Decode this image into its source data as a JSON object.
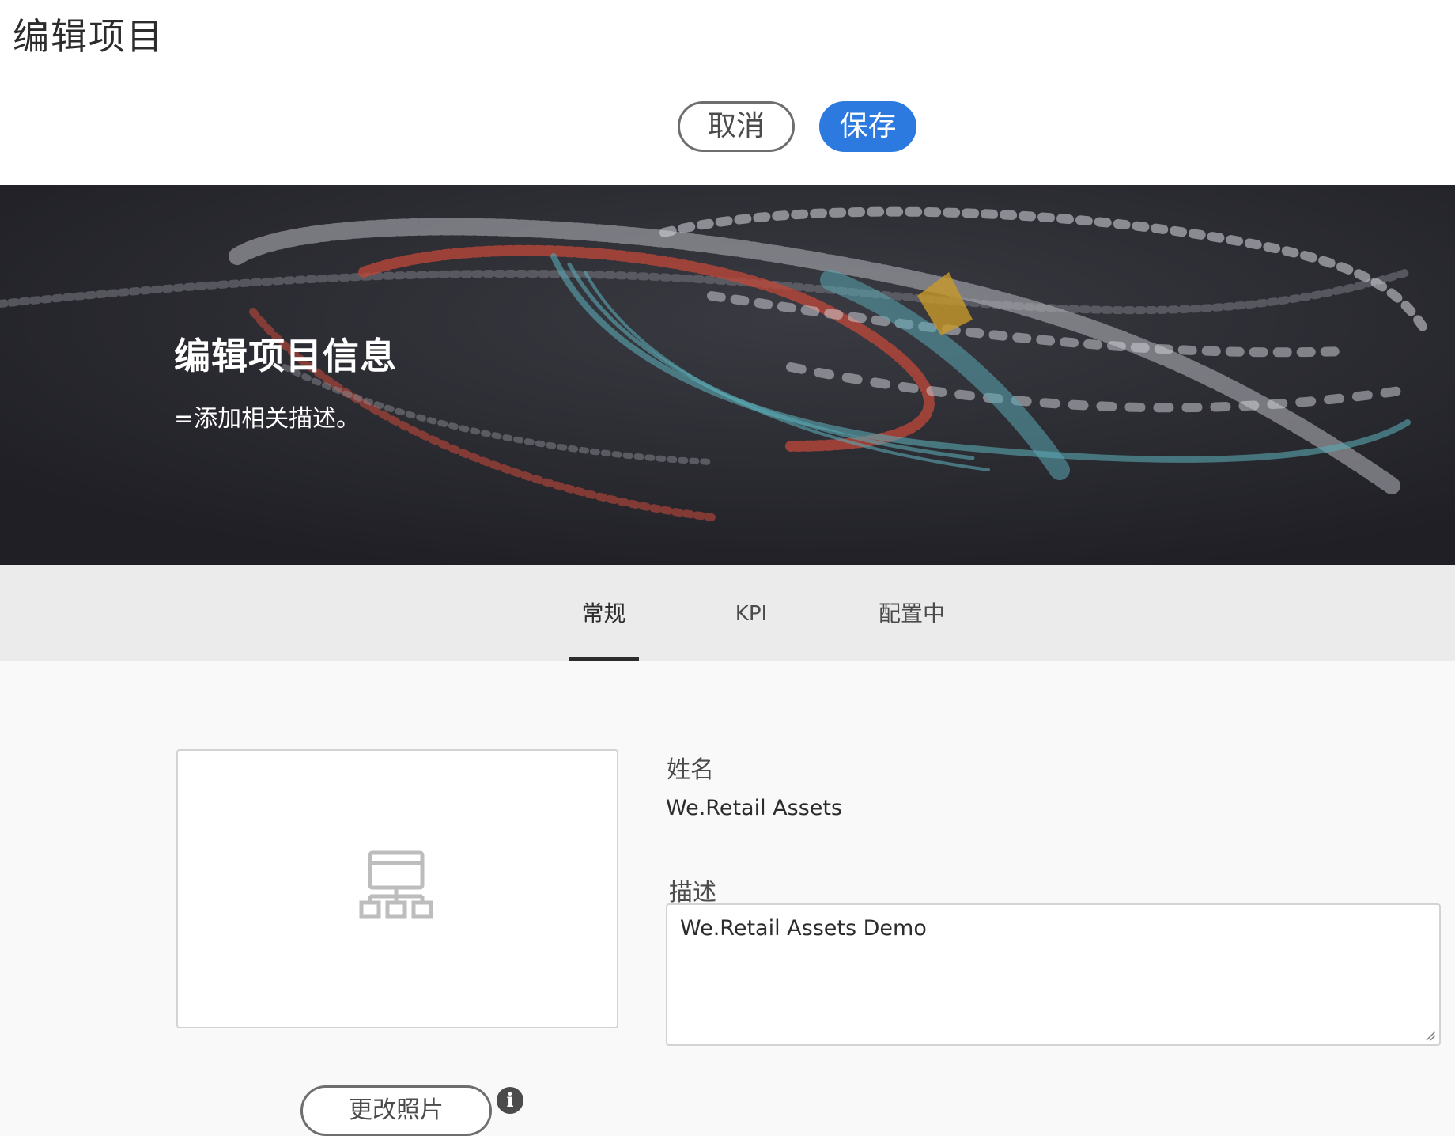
{
  "header": {
    "title": "编辑项目",
    "cancel_label": "取消",
    "save_label": "保存",
    "save_color": "#2c7ae0"
  },
  "hero": {
    "title": "编辑项目信息",
    "subtitle": "=添加相关描述。"
  },
  "tabs": [
    {
      "label": "常规",
      "active": true
    },
    {
      "label": "KPI",
      "active": false
    },
    {
      "label": "配置中",
      "active": false
    }
  ],
  "form": {
    "thumbnail_icon": "site-structure-icon",
    "name_label": "姓名",
    "name_value": "We.Retail Assets",
    "description_label": "描述",
    "description_value": "We.Retail Assets Demo",
    "change_photo_label": "更改照片",
    "info_icon_glyph": "i"
  }
}
